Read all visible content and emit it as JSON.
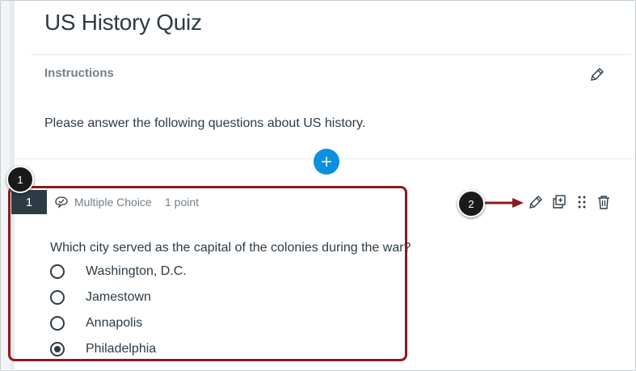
{
  "quiz": {
    "title": "US History Quiz",
    "instructions_label": "Instructions",
    "instructions_text": "Please answer the following questions about US history."
  },
  "question": {
    "number": "1",
    "type": "Multiple Choice",
    "points": "1 point",
    "text": "Which city served as the capital of the colonies during the war?",
    "choices": [
      {
        "label": "Washington, D.C.",
        "selected": false
      },
      {
        "label": "Jamestown",
        "selected": false
      },
      {
        "label": "Annapolis",
        "selected": false
      },
      {
        "label": "Philadelphia",
        "selected": true
      }
    ]
  },
  "callouts": {
    "first": "1",
    "second": "2"
  },
  "icons": {
    "instructions_edit": "pencil-icon",
    "add": "plus-icon",
    "question_type": "multiple-choice-icon",
    "edit": "pencil-icon",
    "copy": "copy-icon",
    "drag": "drag-handle-icon",
    "delete": "trash-icon"
  },
  "colors": {
    "accent": "#0b8fdf",
    "highlight_border": "#8b1a1f",
    "text": "#2d3b45",
    "muted": "#73818c"
  }
}
